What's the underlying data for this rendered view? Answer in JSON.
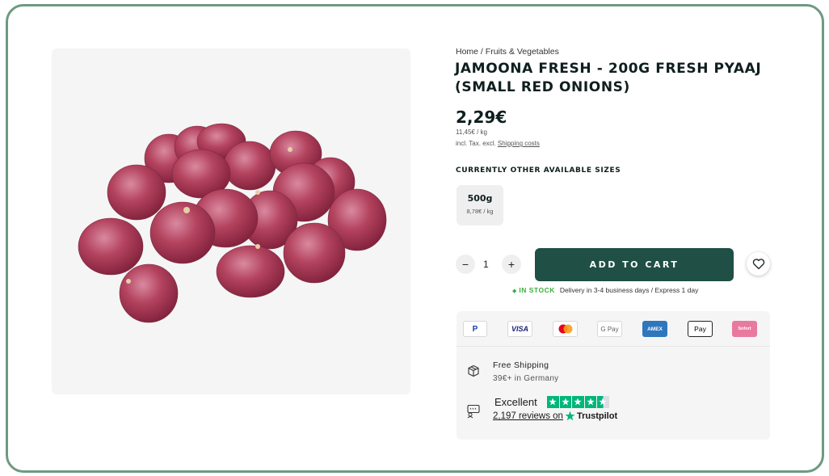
{
  "breadcrumb": {
    "home": "Home",
    "separator": " / ",
    "category": "Fruits & Vegetables"
  },
  "product": {
    "title": "JAMOONA FRESH - 200G FRESH PYAAJ (SMALL RED ONIONS)",
    "price": "2,29€",
    "unit_price": "11,45€ / kg",
    "tax_prefix": "incl. Tax. excl. ",
    "shipping_link": "Shipping costs",
    "image_icon": "onions-image"
  },
  "sizes": {
    "heading": "CURRENTLY OTHER AVAILABLE SIZES",
    "options": [
      {
        "label": "500g",
        "price": "8,78€ / kg"
      }
    ]
  },
  "cart": {
    "quantity": "1",
    "minus_label": "−",
    "plus_label": "+",
    "add_label": "ADD TO CART",
    "wishlist_icon": "heart-icon"
  },
  "stock": {
    "status": "IN STOCK",
    "delivery": "Delivery in 3-4 business days / Express 1 day",
    "color": "#3fae3f"
  },
  "payments": {
    "paypal": "P",
    "visa": "VISA",
    "mastercard": "mastercard-icon",
    "gpay": "G Pay",
    "amex": "AMEX",
    "applepay": " Pay",
    "sofort": "Sofort"
  },
  "shipping": {
    "title": "Free Shipping",
    "subtitle": "39€+ in Germany",
    "icon": "box-icon"
  },
  "trustpilot": {
    "rating_text": "Excellent",
    "stars": 4.5,
    "reviews": "2,197 reviews on",
    "brand": "Trustpilot",
    "color": "#00b67a"
  },
  "colors": {
    "accent": "#1f4f45",
    "frame": "#6e9a82"
  }
}
